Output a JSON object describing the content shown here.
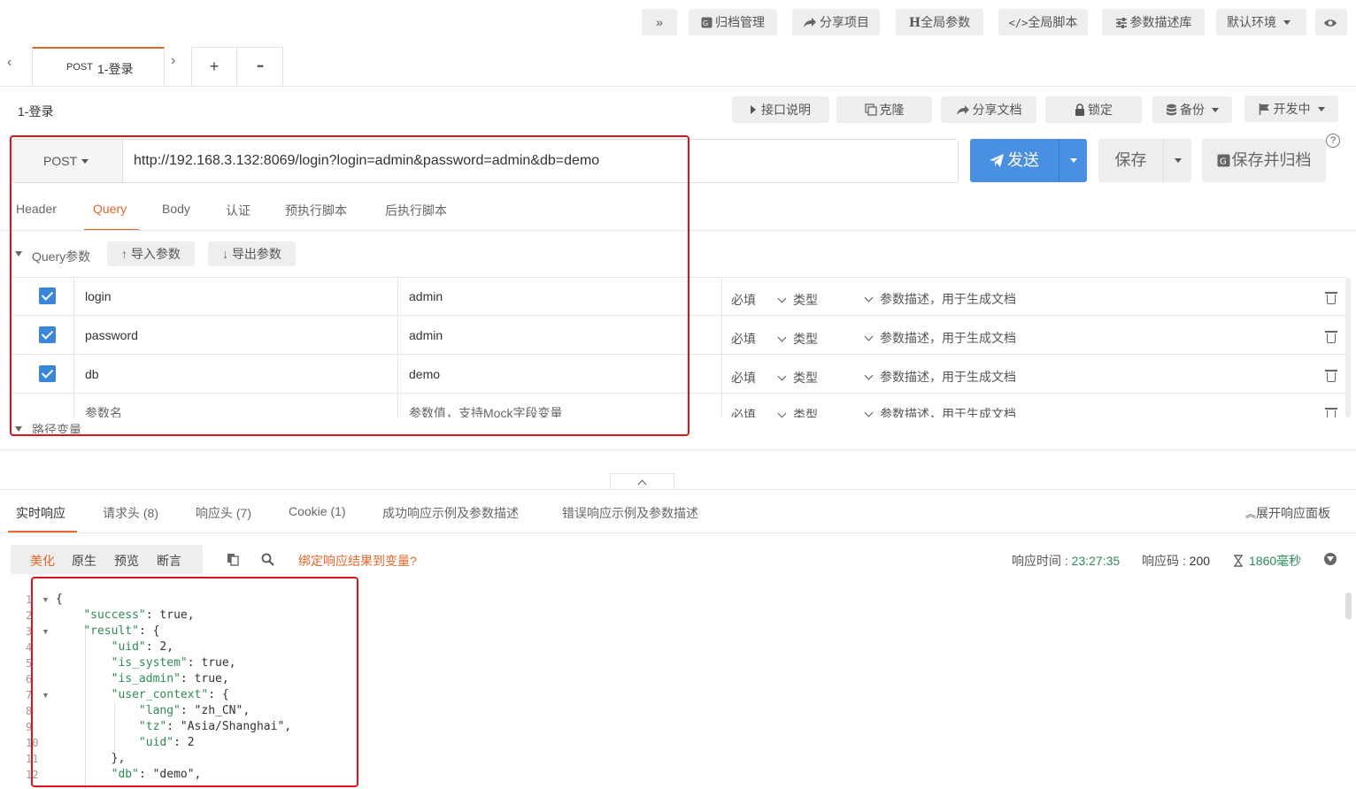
{
  "toolbar": {
    "expand": "»",
    "archive": "归档管理",
    "share_project": "分享项目",
    "global_params": "全局参数",
    "global_script": "全局脚本",
    "param_desc_lib": "参数描述库",
    "env": "默认环境"
  },
  "tabs": {
    "active_method": "POST",
    "active_title": "1-登录",
    "add": "+",
    "more": "•••"
  },
  "api": {
    "title": "1-登录",
    "doc_btn": "接口说明",
    "clone_btn": "克隆",
    "share_doc_btn": "分享文档",
    "lock_btn": "锁定",
    "backup_btn": "备份",
    "status_btn": "开发中"
  },
  "request": {
    "method": "POST",
    "url": "http://192.168.3.132:8069/login?login=admin&password=admin&db=demo",
    "send": "发送",
    "save": "保存",
    "save_archive": "保存并归档"
  },
  "req_tabs": [
    "Header",
    "Query",
    "Body",
    "认证",
    "预执行脚本",
    "后执行脚本"
  ],
  "query": {
    "section_title": "Query参数",
    "import_btn": "导入参数",
    "export_btn": "导出参数",
    "rows": [
      {
        "name": "login",
        "value": "admin",
        "required": "必填",
        "type": "类型",
        "desc": "参数描述，用于生成文档"
      },
      {
        "name": "password",
        "value": "admin",
        "required": "必填",
        "type": "类型",
        "desc": "参数描述，用于生成文档"
      },
      {
        "name": "db",
        "value": "demo",
        "required": "必填",
        "type": "类型",
        "desc": "参数描述，用于生成文档"
      }
    ],
    "placeholder_row": {
      "name": "参数名",
      "value": "参数值，支持Mock字段变量",
      "required": "必填",
      "type": "类型",
      "desc": "参数描述，用于生成文档"
    },
    "path_vars": "路径变量"
  },
  "resp_tabs": [
    "实时响应",
    "请求头 (8)",
    "响应头 (7)",
    "Cookie (1)",
    "成功响应示例及参数描述",
    "错误响应示例及参数描述"
  ],
  "resp_panel": {
    "expand": "展开响应面板",
    "view_modes": [
      "美化",
      "原生",
      "预览",
      "断言"
    ],
    "bind_var": "绑定响应结果到变量?",
    "resp_time_label": "响应时间 :",
    "resp_time": "23:27:35",
    "resp_code_label": "响应码 :",
    "resp_code": "200",
    "duration": "1860毫秒"
  },
  "response_lines": [
    "{",
    "    \"success\": true,",
    "    \"result\": {",
    "        \"uid\": 2,",
    "        \"is_system\": true,",
    "        \"is_admin\": true,",
    "        \"user_context\": {",
    "            \"lang\": \"zh_CN\",",
    "            \"tz\": \"Asia/Shanghai\",",
    "            \"uid\": 2",
    "        },",
    "        \"db\": \"demo\","
  ],
  "colors": {
    "primary": "#4a90e2",
    "accent_orange": "#e4662a",
    "highlight": "#e0141e"
  }
}
